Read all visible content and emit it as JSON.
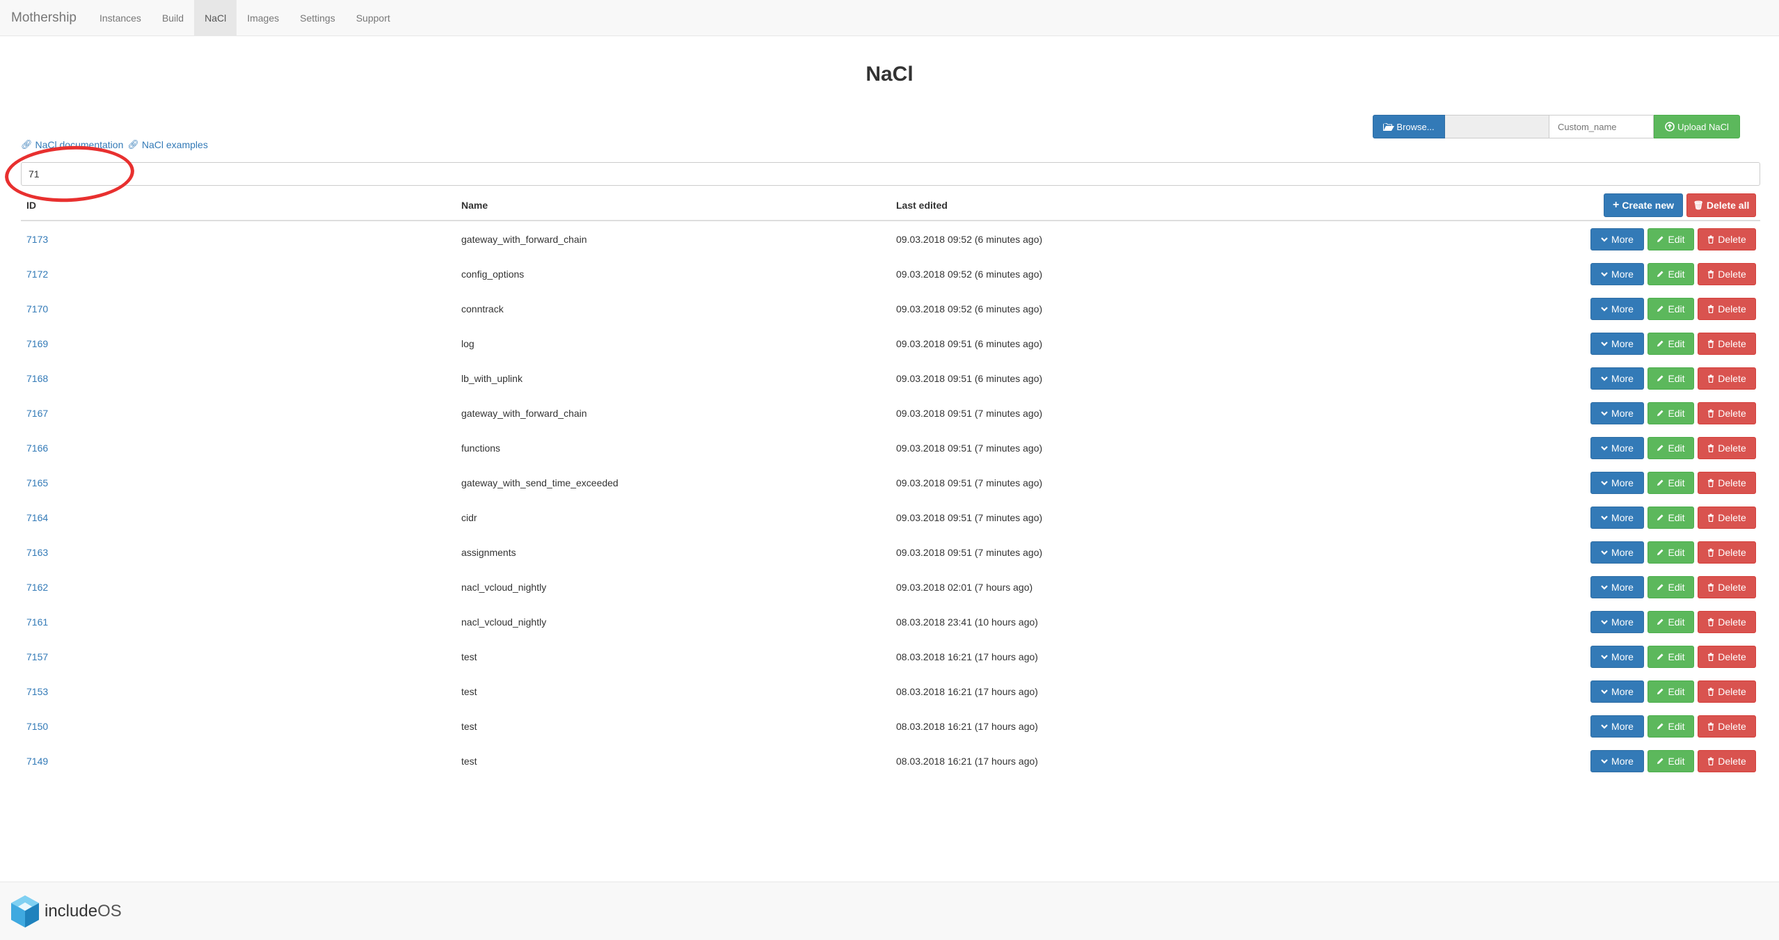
{
  "navbar": {
    "brand": "Mothership",
    "items": [
      {
        "label": "Instances",
        "active": false
      },
      {
        "label": "Build",
        "active": false
      },
      {
        "label": "NaCl",
        "active": true
      },
      {
        "label": "Images",
        "active": false
      },
      {
        "label": "Settings",
        "active": false
      },
      {
        "label": "Support",
        "active": false
      }
    ]
  },
  "page_title": "NaCl",
  "upload": {
    "browse_label": "Browse...",
    "custom_name_placeholder": "Custom_name",
    "upload_label": "Upload NaCl"
  },
  "links": {
    "documentation": "NaCl documentation",
    "examples": "NaCl examples"
  },
  "filter": {
    "value": "71"
  },
  "table": {
    "headers": {
      "id": "ID",
      "name": "Name",
      "last_edited": "Last edited"
    },
    "create_label": "Create new",
    "delete_all_label": "Delete all",
    "more_label": "More",
    "edit_label": "Edit",
    "delete_label": "Delete",
    "rows": [
      {
        "id": "7173",
        "name": "gateway_with_forward_chain",
        "edited": "09.03.2018 09:52 (6 minutes ago)"
      },
      {
        "id": "7172",
        "name": "config_options",
        "edited": "09.03.2018 09:52 (6 minutes ago)"
      },
      {
        "id": "7170",
        "name": "conntrack",
        "edited": "09.03.2018 09:52 (6 minutes ago)"
      },
      {
        "id": "7169",
        "name": "log",
        "edited": "09.03.2018 09:51 (6 minutes ago)"
      },
      {
        "id": "7168",
        "name": "lb_with_uplink",
        "edited": "09.03.2018 09:51 (6 minutes ago)"
      },
      {
        "id": "7167",
        "name": "gateway_with_forward_chain",
        "edited": "09.03.2018 09:51 (7 minutes ago)"
      },
      {
        "id": "7166",
        "name": "functions",
        "edited": "09.03.2018 09:51 (7 minutes ago)"
      },
      {
        "id": "7165",
        "name": "gateway_with_send_time_exceeded",
        "edited": "09.03.2018 09:51 (7 minutes ago)"
      },
      {
        "id": "7164",
        "name": "cidr",
        "edited": "09.03.2018 09:51 (7 minutes ago)"
      },
      {
        "id": "7163",
        "name": "assignments",
        "edited": "09.03.2018 09:51 (7 minutes ago)"
      },
      {
        "id": "7162",
        "name": "nacl_vcloud_nightly",
        "edited": "09.03.2018 02:01 (7 hours ago)"
      },
      {
        "id": "7161",
        "name": "nacl_vcloud_nightly",
        "edited": "08.03.2018 23:41 (10 hours ago)"
      },
      {
        "id": "7157",
        "name": "test",
        "edited": "08.03.2018 16:21 (17 hours ago)"
      },
      {
        "id": "7153",
        "name": "test",
        "edited": "08.03.2018 16:21 (17 hours ago)"
      },
      {
        "id": "7150",
        "name": "test",
        "edited": "08.03.2018 16:21 (17 hours ago)"
      },
      {
        "id": "7149",
        "name": "test",
        "edited": "08.03.2018 16:21 (17 hours ago)"
      }
    ]
  },
  "footer": {
    "logo_text_a": "include",
    "logo_text_b": "OS"
  },
  "colors": {
    "primary": "#337ab7",
    "success": "#5cb85c",
    "danger": "#d9534f",
    "highlight": "#e8302f"
  }
}
